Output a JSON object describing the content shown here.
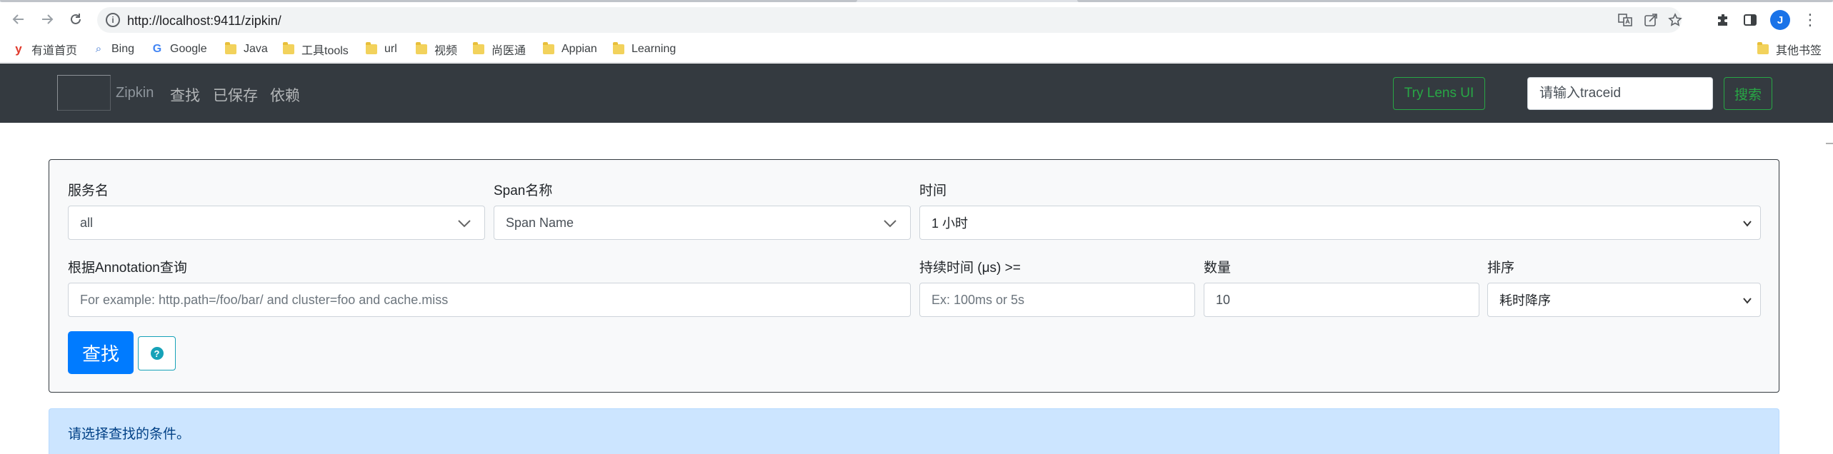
{
  "browser": {
    "url": "http://localhost:9411/zipkin/",
    "bookmarks": [
      {
        "label": "有道首页",
        "icon": "youdao-icon"
      },
      {
        "label": "Bing",
        "icon": "bing-icon"
      },
      {
        "label": "Google",
        "icon": "google-icon"
      },
      {
        "label": "Java",
        "icon": "folder-icon"
      },
      {
        "label": "工具tools",
        "icon": "folder-icon"
      },
      {
        "label": "url",
        "icon": "folder-icon"
      },
      {
        "label": "视频",
        "icon": "folder-icon"
      },
      {
        "label": "尚医通",
        "icon": "folder-icon"
      },
      {
        "label": "Appian",
        "icon": "folder-icon"
      },
      {
        "label": "Learning",
        "icon": "folder-icon"
      }
    ],
    "other_bookmarks": "其他书签",
    "avatar_letter": "J"
  },
  "navbar": {
    "brand": "Zipkin",
    "links": [
      "查找",
      "已保存",
      "依赖"
    ],
    "lens_button": "Try Lens UI",
    "traceid_placeholder": "请输入traceid",
    "search_button": "搜索"
  },
  "form": {
    "service": {
      "label": "服务名",
      "value": "all"
    },
    "span": {
      "label": "Span名称",
      "value": "Span Name"
    },
    "time": {
      "label": "时间",
      "value": "1 小时"
    },
    "annotation": {
      "label": "根据Annotation查询",
      "placeholder": "For example: http.path=/foo/bar/ and cluster=foo and cache.miss"
    },
    "duration": {
      "label": "持续时间 (μs) >=",
      "placeholder": "Ex: 100ms or 5s"
    },
    "limit": {
      "label": "数量",
      "value": "10"
    },
    "sort": {
      "label": "排序",
      "value": "耗时降序"
    },
    "find_button": "查找",
    "help_glyph": "?"
  },
  "alert": {
    "message": "请选择查找的条件。"
  },
  "colors": {
    "navbar_bg": "#343a40",
    "success": "#28a745",
    "primary": "#007bff",
    "info": "#17a2b8",
    "alert_bg": "#cce5ff",
    "alert_text": "#004085"
  }
}
